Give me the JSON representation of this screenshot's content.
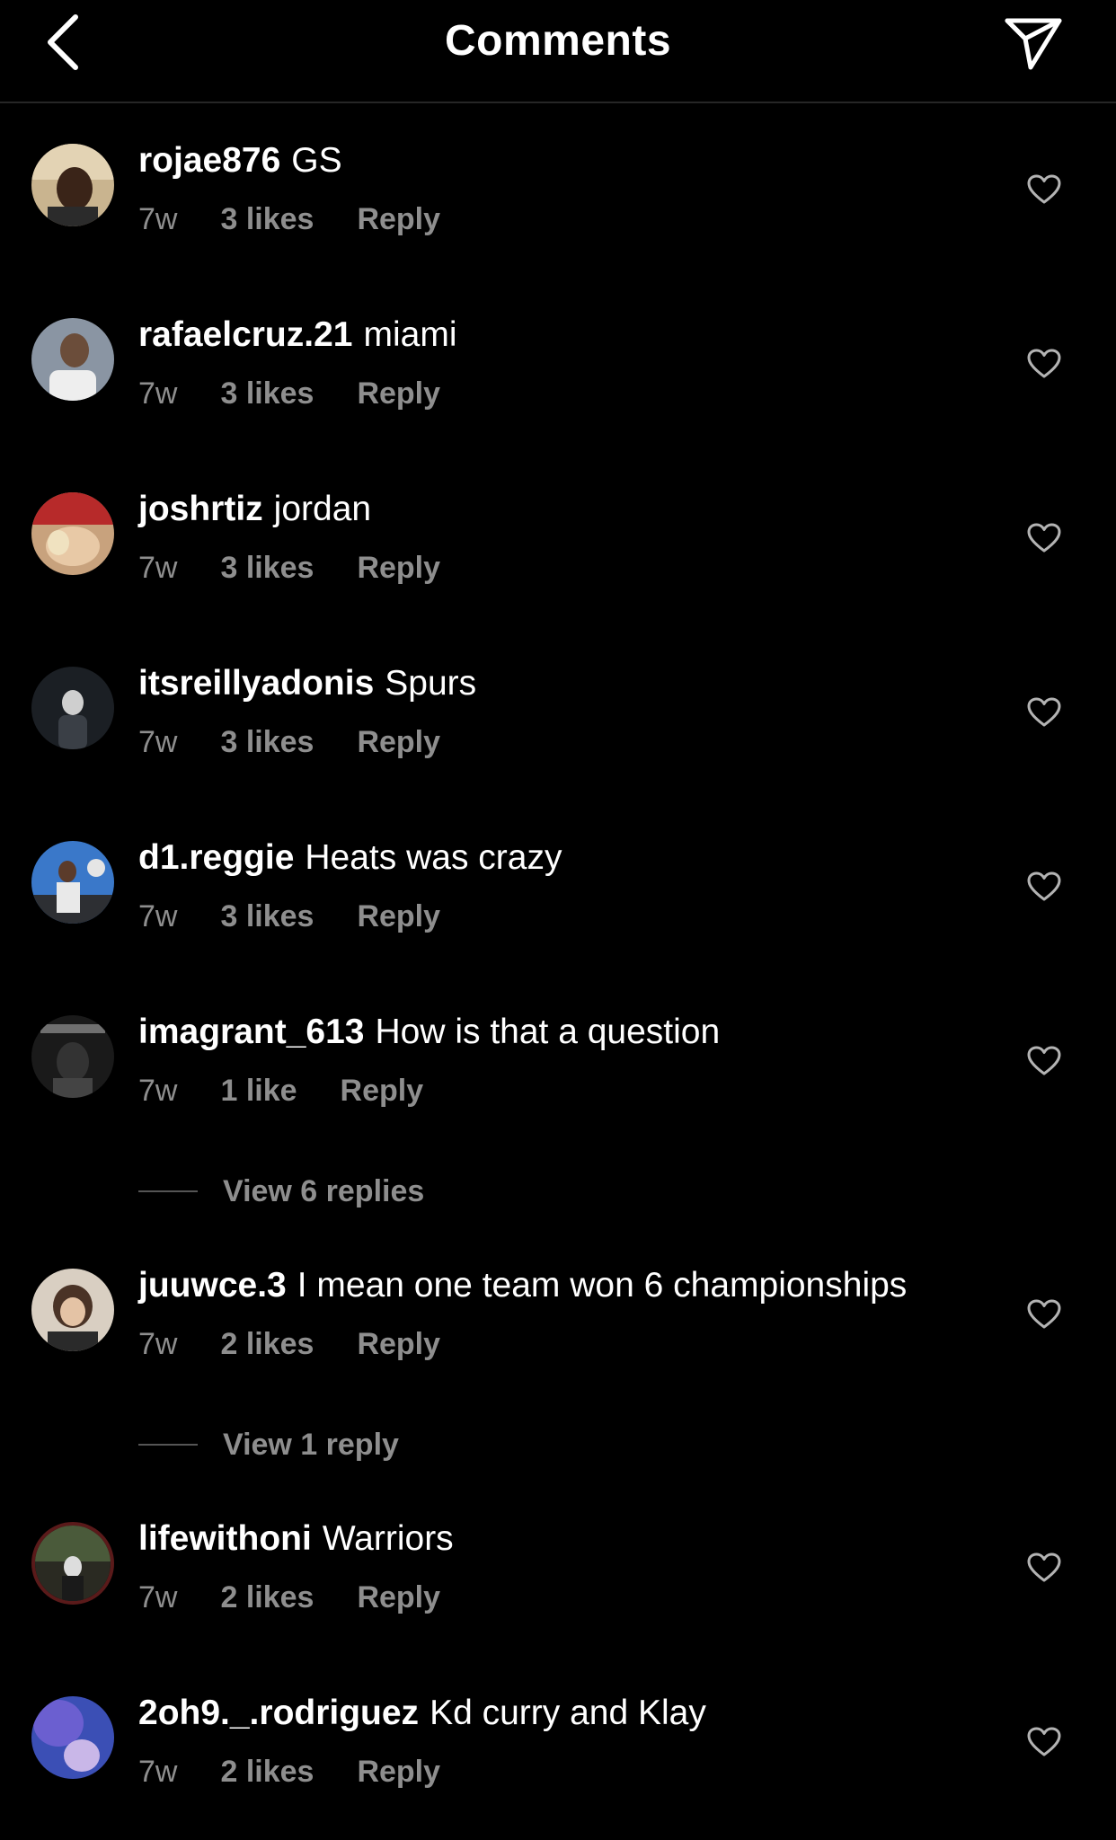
{
  "header": {
    "title": "Comments",
    "back_icon": "chevron-left-icon",
    "share_icon": "paper-plane-icon"
  },
  "comments": [
    {
      "username": "rojae876",
      "text": "GS",
      "time": "7w",
      "likes": "3 likes",
      "reply": "Reply"
    },
    {
      "username": "rafaelcruz.21",
      "text": "miami",
      "time": "7w",
      "likes": "3 likes",
      "reply": "Reply"
    },
    {
      "username": "joshrtiz",
      "text": "jordan",
      "time": "7w",
      "likes": "3 likes",
      "reply": "Reply"
    },
    {
      "username": "itsreillyadonis",
      "text": "Spurs",
      "time": "7w",
      "likes": "3 likes",
      "reply": "Reply"
    },
    {
      "username": "d1.reggie",
      "text": "Heats was crazy",
      "time": "7w",
      "likes": "3 likes",
      "reply": "Reply"
    },
    {
      "username": "imagrant_613",
      "text": "How is that a question",
      "time": "7w",
      "likes": "1 like",
      "reply": "Reply",
      "view_replies": "View 6 replies"
    },
    {
      "username": "juuwce.3",
      "text": "I mean one team won 6 championships",
      "time": "7w",
      "likes": "2 likes",
      "reply": "Reply",
      "view_replies": "View 1 reply"
    },
    {
      "username": "lifewithoni",
      "text": "Warriors",
      "time": "7w",
      "likes": "2 likes",
      "reply": "Reply"
    },
    {
      "username": "2oh9._.rodriguez",
      "text": "Kd curry and Klay",
      "time": "7w",
      "likes": "2 likes",
      "reply": "Reply"
    }
  ],
  "colors": {
    "background": "#000000",
    "text": "#ffffff",
    "secondary_text": "#8e8e8e",
    "divider": "#262626"
  }
}
